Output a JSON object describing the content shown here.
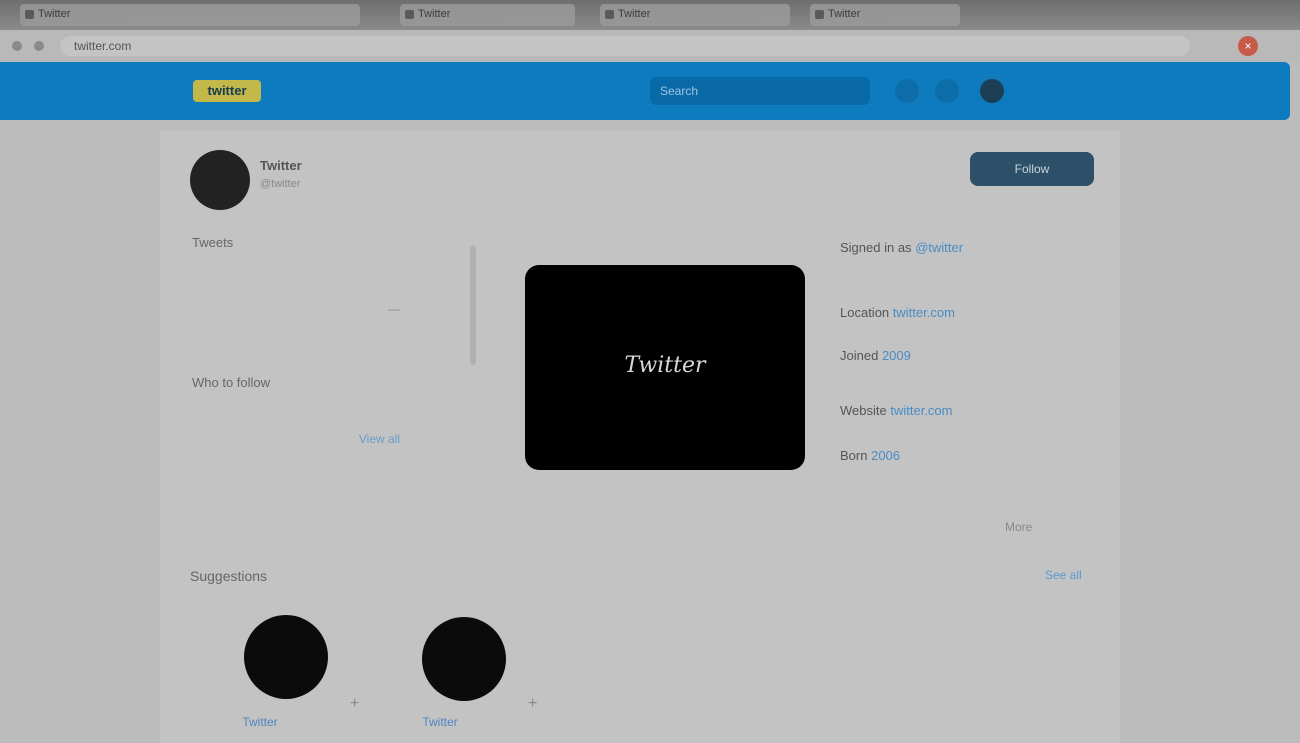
{
  "browser": {
    "tabs": [
      "Twitter",
      "Twitter",
      "Twitter",
      "Twitter"
    ],
    "url": "twitter.com"
  },
  "header": {
    "logo": "twitter",
    "search_placeholder": "Search"
  },
  "profile": {
    "name": "Twitter",
    "subtitle": "@twitter",
    "follow_label": "Follow"
  },
  "left_panel": {
    "label_1": "Tweets",
    "value_1": "—",
    "label_2": "Who to follow",
    "link_2": "View all"
  },
  "preview": {
    "text": "Twitter",
    "caption": ""
  },
  "info": {
    "lines": [
      {
        "text": "Signed in as",
        "link": "@twitter"
      },
      {
        "text": "Location",
        "link": "twitter.com"
      },
      {
        "text": "Joined",
        "link": "2009"
      },
      {
        "text": "Website",
        "link": "twitter.com"
      },
      {
        "text": "Born",
        "link": "2006"
      }
    ],
    "more": "More"
  },
  "suggestions": {
    "title": "Suggestions",
    "see_all": "See all",
    "items": [
      {
        "name": "Twitter"
      },
      {
        "name": "Twitter"
      }
    ]
  },
  "colors": {
    "header_blue": "#0f7bbf",
    "logo_yellow": "#c2b94a",
    "link_blue": "#4a8cc4"
  }
}
